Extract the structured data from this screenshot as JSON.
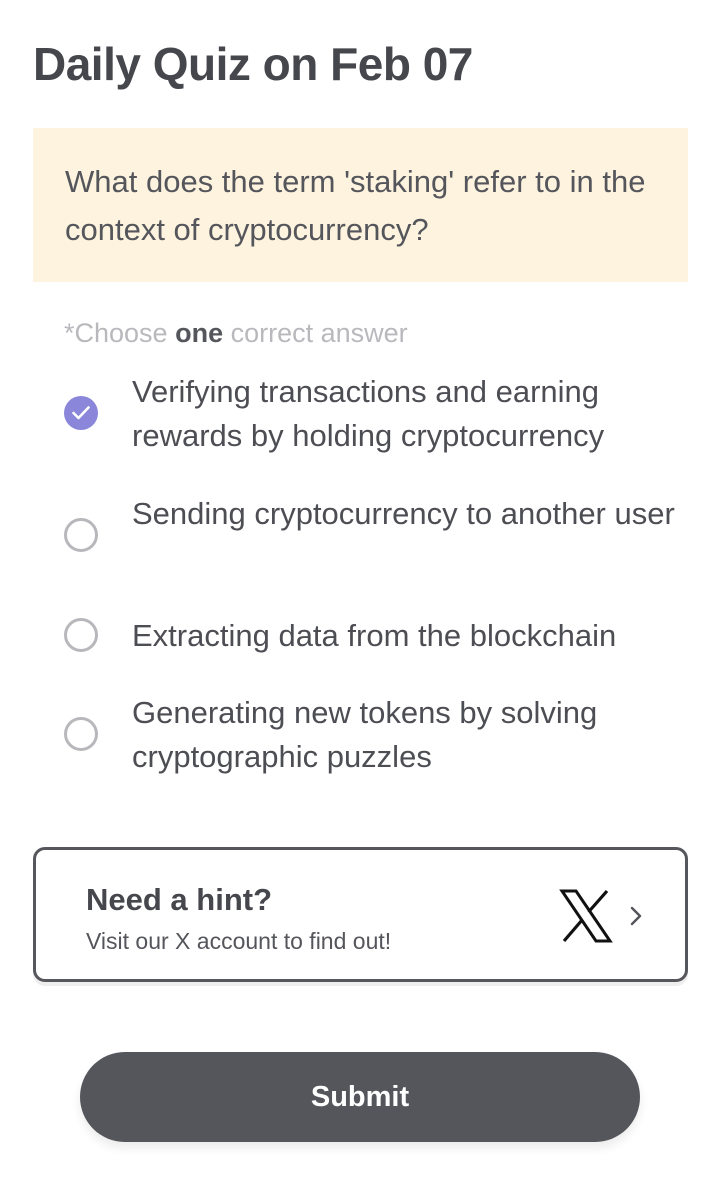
{
  "header": {
    "title": "Daily Quiz on Feb 07"
  },
  "question": {
    "text": "What does the term 'staking' refer to in the context of cryptocurrency?"
  },
  "instruction": {
    "prefix": "*Choose ",
    "emphasis": "one",
    "suffix": " correct answer"
  },
  "options": [
    {
      "label": "Verifying transactions and earning rewards by holding cryptocurrency",
      "selected": true
    },
    {
      "label": "Sending cryptocurrency to another user",
      "selected": false
    },
    {
      "label": "Extracting data from the blockchain",
      "selected": false
    },
    {
      "label": "Generating new tokens by solving cryptographic puzzles",
      "selected": false
    }
  ],
  "hint": {
    "title": "Need a hint?",
    "subtitle": "Visit our X account to find out!",
    "icon": "x-logo-icon"
  },
  "submit": {
    "label": "Submit"
  },
  "colors": {
    "accent": "#8a86d9",
    "question_bg": "#fdf3de",
    "button_bg": "#55565c"
  }
}
